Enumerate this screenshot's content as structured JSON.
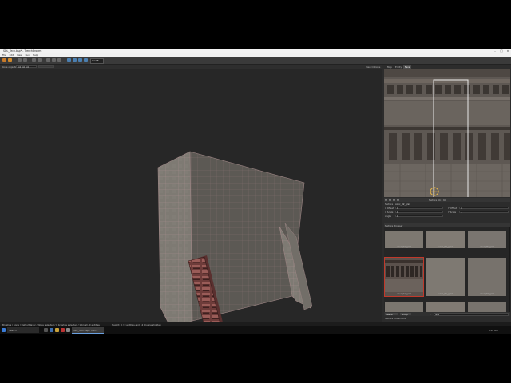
{
  "window": {
    "title": "SDL_Tech.bsp* - TrenchBroom"
  },
  "menu": [
    "File",
    "Edit",
    "View",
    "Run",
    "Help"
  ],
  "toolbar": {
    "grid_label": "Grid 8"
  },
  "options": {
    "move_label": "Move objects",
    "move_value": "0.0 0.0 0.0",
    "view_options_label": "View Options"
  },
  "tabs": [
    "Map",
    "Entity",
    "Face"
  ],
  "texture_editor": {
    "readout": "Texture 64 x 64"
  },
  "face_attrs": {
    "texture_label": "Texture",
    "texture_value": "conc_02_grs3",
    "xoffset_label": "X Offset",
    "xoffset_value": "0",
    "yoffset_label": "Y Offset",
    "yoffset_value": "0",
    "xscale_label": "X Scale",
    "xscale_value": "1",
    "yscale_label": "Y Scale",
    "yscale_value": "1",
    "angle_label": "Angle",
    "angle_value": "0"
  },
  "browser": {
    "title": "Texture Browser",
    "textures": [
      {
        "name": "conc_02_grs3"
      },
      {
        "name": "conc_04_grs2"
      },
      {
        "name": "conc_05_grs3"
      },
      {
        "name": "conc_06_grs4"
      },
      {
        "name": "conc_02_grs3"
      },
      {
        "name": "conc_03_grs4"
      }
    ],
    "sort_label": "Name",
    "group_label": "Group",
    "search_placeholder": "Filter",
    "search_value": "grs3",
    "collections_label": "Texture Collections"
  },
  "status": {
    "text": "Brushes / none / Default layer / None selected / 0 brushes selected / 1 brush, 0 entities",
    "right": "Height: 0 / 0 entities and 12 brushes hidden"
  },
  "taskbar": {
    "search_label": "Search",
    "app_label": "SDL_Tech.bsp - Tren...",
    "clock": "9:42 AM"
  }
}
